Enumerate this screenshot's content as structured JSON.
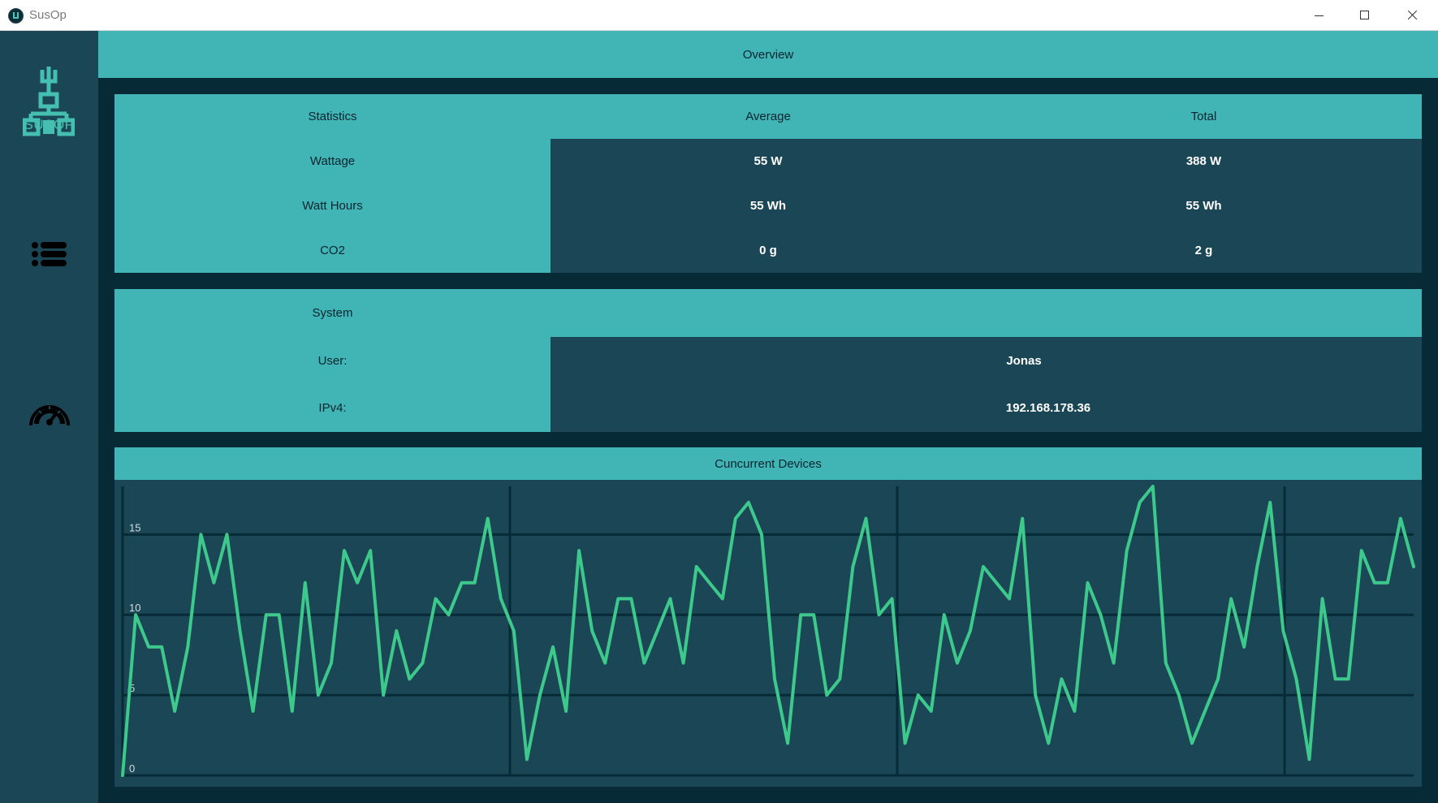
{
  "window": {
    "title": "SusOp"
  },
  "sidebar": {
    "logo_text": "SUSOP",
    "items": [
      {
        "icon": "list-icon"
      },
      {
        "icon": "speedometer-icon"
      }
    ]
  },
  "header": {
    "title": "Overview"
  },
  "statistics": {
    "headers": [
      "Statistics",
      "Average",
      "Total"
    ],
    "rows": [
      {
        "label": "Wattage",
        "average": "55 W",
        "total": "388 W"
      },
      {
        "label": "Watt Hours",
        "average": "55 Wh",
        "total": "55 Wh"
      },
      {
        "label": "CO2",
        "average": "0 g",
        "total": "2 g"
      }
    ]
  },
  "system": {
    "title": "System",
    "user_label": "User:",
    "user_value": "Jonas",
    "ip_label": "IPv4:",
    "ip_value": "192.168.178.36"
  },
  "colors": {
    "accent": "#41b4b5",
    "panel": "#1b4655",
    "background": "#062b36",
    "line": "#3ec98c"
  },
  "chart_data": {
    "type": "line",
    "title": "Cuncurrent Devices",
    "xlabel": "",
    "ylabel": "",
    "ylim": [
      0,
      18
    ],
    "yticks": [
      0,
      5,
      10,
      15
    ],
    "grid": true,
    "series": [
      {
        "values": [
          0,
          10,
          8,
          8,
          4,
          8,
          15,
          12,
          15,
          9,
          4,
          10,
          10,
          4,
          12,
          5,
          7,
          14,
          12,
          14,
          5,
          9,
          6,
          7,
          11,
          10,
          12,
          12,
          16,
          11,
          9,
          1,
          5,
          8,
          4,
          14,
          9,
          7,
          11,
          11,
          7,
          9,
          11,
          7,
          13,
          12,
          11,
          16,
          17,
          15,
          6,
          2,
          10,
          10,
          5,
          6,
          13,
          16,
          10,
          11,
          2,
          5,
          4,
          10,
          7,
          9,
          13,
          12,
          11,
          16,
          5,
          2,
          6,
          4,
          12,
          10,
          7,
          14,
          17,
          18,
          7,
          5,
          2,
          4,
          6,
          11,
          8,
          13,
          17,
          9,
          6,
          1,
          11,
          6,
          6,
          14,
          12,
          12,
          16,
          13
        ]
      }
    ]
  }
}
